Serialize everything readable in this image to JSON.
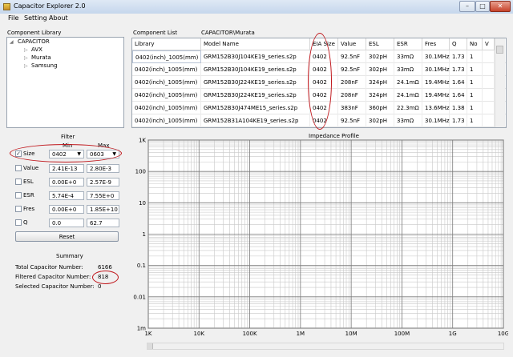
{
  "window": {
    "title": "Capacitor Explorer 2.0",
    "minimize": "–",
    "maximize": "□",
    "close": "✕"
  },
  "menu": [
    "File",
    "Setting",
    "About"
  ],
  "library": {
    "title": "Component Library",
    "root": "CAPACITOR",
    "children": [
      "AVX",
      "Murata",
      "Samsung"
    ]
  },
  "component_list": {
    "title": "Component List",
    "path": "CAPACITOR\\Murata"
  },
  "table": {
    "columns": [
      "Library",
      "Model Name",
      "EIA Size",
      "Value",
      "ESL",
      "ESR",
      "Fres",
      "Q",
      "No",
      "V"
    ],
    "rows": [
      [
        "0402(inch)_1005(mm)",
        "GRM152B30J104KE19_series.s2p",
        "0402",
        "92.5nF",
        "302pH",
        "33mΩ",
        "30.1MHz",
        "1.73",
        "1",
        ""
      ],
      [
        "0402(inch)_1005(mm)",
        "GRM152B30J104KE19_series.s2p",
        "0402",
        "92.5nF",
        "302pH",
        "33mΩ",
        "30.1MHz",
        "1.73",
        "1",
        ""
      ],
      [
        "0402(inch)_1005(mm)",
        "GRM152B30J224KE19_series.s2p",
        "0402",
        "208nF",
        "324pH",
        "24.1mΩ",
        "19.4MHz",
        "1.64",
        "1",
        ""
      ],
      [
        "0402(inch)_1005(mm)",
        "GRM152B30J224KE19_series.s2p",
        "0402",
        "208nF",
        "324pH",
        "24.1mΩ",
        "19.4MHz",
        "1.64",
        "1",
        ""
      ],
      [
        "0402(inch)_1005(mm)",
        "GRM152B30J474ME15_series.s2p",
        "0402",
        "383nF",
        "360pH",
        "22.3mΩ",
        "13.6MHz",
        "1.38",
        "1",
        ""
      ],
      [
        "0402(inch)_1005(mm)",
        "GRM152B31A104KE19_series.s2p",
        "0402",
        "92.5nF",
        "302pH",
        "33mΩ",
        "30.1MHz",
        "1.73",
        "1",
        ""
      ]
    ]
  },
  "filter": {
    "title": "Filter",
    "min_label": "Min",
    "max_label": "Max",
    "size": {
      "label": "Size",
      "checked": true,
      "min": "0402",
      "max": "0603"
    },
    "params": [
      {
        "label": "Value",
        "min": "2.41E-13",
        "max": "2.80E-3"
      },
      {
        "label": "ESL",
        "min": "0.00E+0",
        "max": "2.57E-9"
      },
      {
        "label": "ESR",
        "min": "5.74E-4",
        "max": "7.55E+0"
      },
      {
        "label": "Fres",
        "min": "0.00E+0",
        "max": "1.85E+10"
      },
      {
        "label": "Q",
        "min": "0.0",
        "max": "62.7"
      }
    ],
    "reset_label": "Reset"
  },
  "summary": {
    "title": "Summary",
    "total_label": "Total Capacitor Number:",
    "total": "6166",
    "filtered_label": "Filtered Capacitor Number:",
    "filtered": "818",
    "selected_label": "Selected Capacitor Number:",
    "selected": "0"
  },
  "chart_data": {
    "type": "line",
    "title": "Impedance Profile",
    "x_scale": "log",
    "y_scale": "log",
    "xlim": [
      1000,
      10000000000
    ],
    "ylim": [
      0.001,
      1000
    ],
    "x_ticks": [
      {
        "v": 1000,
        "label": "1K"
      },
      {
        "v": 10000,
        "label": "10K"
      },
      {
        "v": 100000,
        "label": "100K"
      },
      {
        "v": 1000000,
        "label": "1M"
      },
      {
        "v": 10000000,
        "label": "10M"
      },
      {
        "v": 100000000,
        "label": "100M"
      },
      {
        "v": 1000000000,
        "label": "1G"
      },
      {
        "v": 10000000000,
        "label": "10G"
      }
    ],
    "y_ticks": [
      {
        "v": 1000,
        "label": "1K"
      },
      {
        "v": 100,
        "label": "100"
      },
      {
        "v": 10,
        "label": "10"
      },
      {
        "v": 1,
        "label": "1"
      },
      {
        "v": 0.1,
        "label": "0.1"
      },
      {
        "v": 0.01,
        "label": "0.01"
      },
      {
        "v": 0.001,
        "label": "1m"
      }
    ],
    "grid": true,
    "series": []
  },
  "colors": {
    "annotation": "#c0171c",
    "plot_bg": "#ffffff",
    "grid_major": "#7a7a7a",
    "grid_minor": "#c8c8c8"
  }
}
